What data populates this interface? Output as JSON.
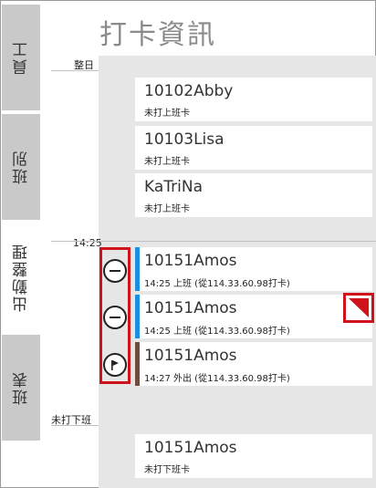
{
  "page": {
    "title": "打卡資訊"
  },
  "sidebar": {
    "tabs": [
      {
        "label": "員工",
        "active": false
      },
      {
        "label": "班別",
        "active": false
      },
      {
        "label": "出勤整理",
        "active": true
      },
      {
        "label": "班表",
        "active": false
      }
    ]
  },
  "sections": {
    "whole_day": "整日",
    "time_1425": "14:25",
    "not_clocked_out": "未打下班"
  },
  "records": [
    {
      "name": "10102Abby",
      "status": "未打上班卡"
    },
    {
      "name": "10103Lisa",
      "status": "未打上班卡"
    },
    {
      "name": "KaTriNa",
      "status": "未打上班卡"
    },
    {
      "name": "10151Amos",
      "status": "14:25 上班 (從114.33.60.98打卡)",
      "stripe_color": "#1a8fe0",
      "action_icon": "minus-circle-icon"
    },
    {
      "name": "10151Amos",
      "status": "14:25 上班 (從114.33.60.98打卡)",
      "stripe_color": "#1a8fe0",
      "action_icon": "minus-circle-icon"
    },
    {
      "name": "10151Amos",
      "status": "14:27 外出 (從114.33.60.98打卡)",
      "stripe_color": "#6b4e3d",
      "action_icon": "flag-circle-icon"
    },
    {
      "name": "10151Amos",
      "status": "未打下班卡"
    }
  ],
  "colors": {
    "accent_red": "#d0121b",
    "clock_in_blue": "#1a8fe0",
    "out_brown": "#6b4e3d"
  }
}
